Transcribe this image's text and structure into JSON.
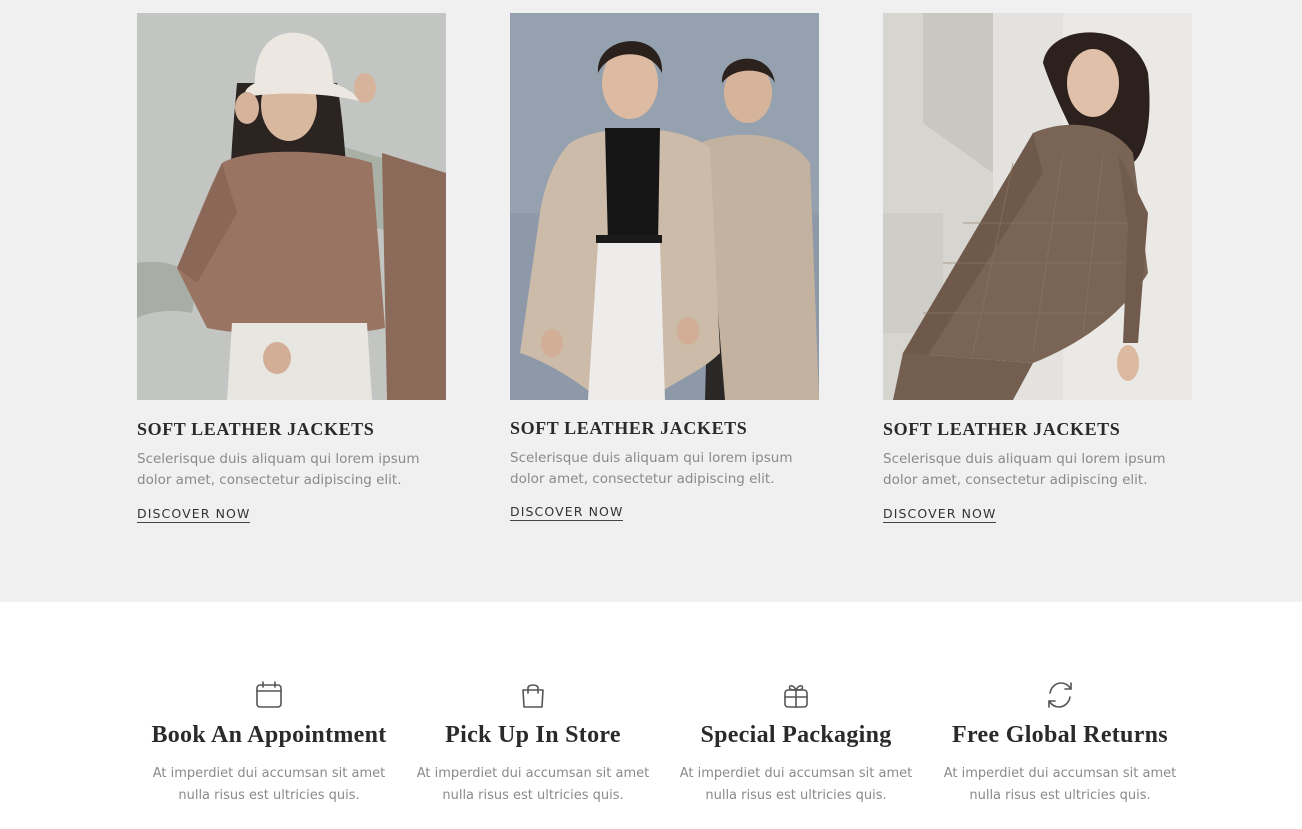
{
  "colors": {
    "section_bg": "#f0f0f0",
    "page_bg": "#ffffff",
    "heading": "#2a2a2a",
    "body_text": "#8a8a8a"
  },
  "products": [
    {
      "image": "woman-white-bucket-hat-brown-top-photo",
      "title": "SOFT LEATHER JACKETS",
      "description": "Scelerisque duis aliquam qui lorem ipsum dolor amet, consectetur adipiscing elit.",
      "link": "DISCOVER NOW"
    },
    {
      "image": "two-models-beige-trench-coats-photo",
      "title": "SOFT LEATHER JACKETS",
      "description": "Scelerisque duis aliquam qui lorem ipsum dolor amet, consectetur adipiscing elit.",
      "link": "DISCOVER NOW"
    },
    {
      "image": "woman-plaid-brown-suit-leaning-wall-photo",
      "title": "SOFT LEATHER JACKETS",
      "description": "Scelerisque duis aliquam qui lorem ipsum dolor amet, consectetur adipiscing elit.",
      "link": "DISCOVER NOW"
    }
  ],
  "features": [
    {
      "icon": "calendar-icon",
      "title": "Book An Appointment",
      "description": "At imperdiet dui accumsan sit amet nulla risus est ultricies quis."
    },
    {
      "icon": "shopping-bag-icon",
      "title": "Pick Up In Store",
      "description": "At imperdiet dui accumsan sit amet nulla risus est ultricies quis."
    },
    {
      "icon": "gift-icon",
      "title": "Special Packaging",
      "description": "At imperdiet dui accumsan sit amet nulla risus est ultricies quis."
    },
    {
      "icon": "refresh-icon",
      "title": "Free Global Returns",
      "description": "At imperdiet dui accumsan sit amet nulla risus est ultricies quis."
    }
  ]
}
